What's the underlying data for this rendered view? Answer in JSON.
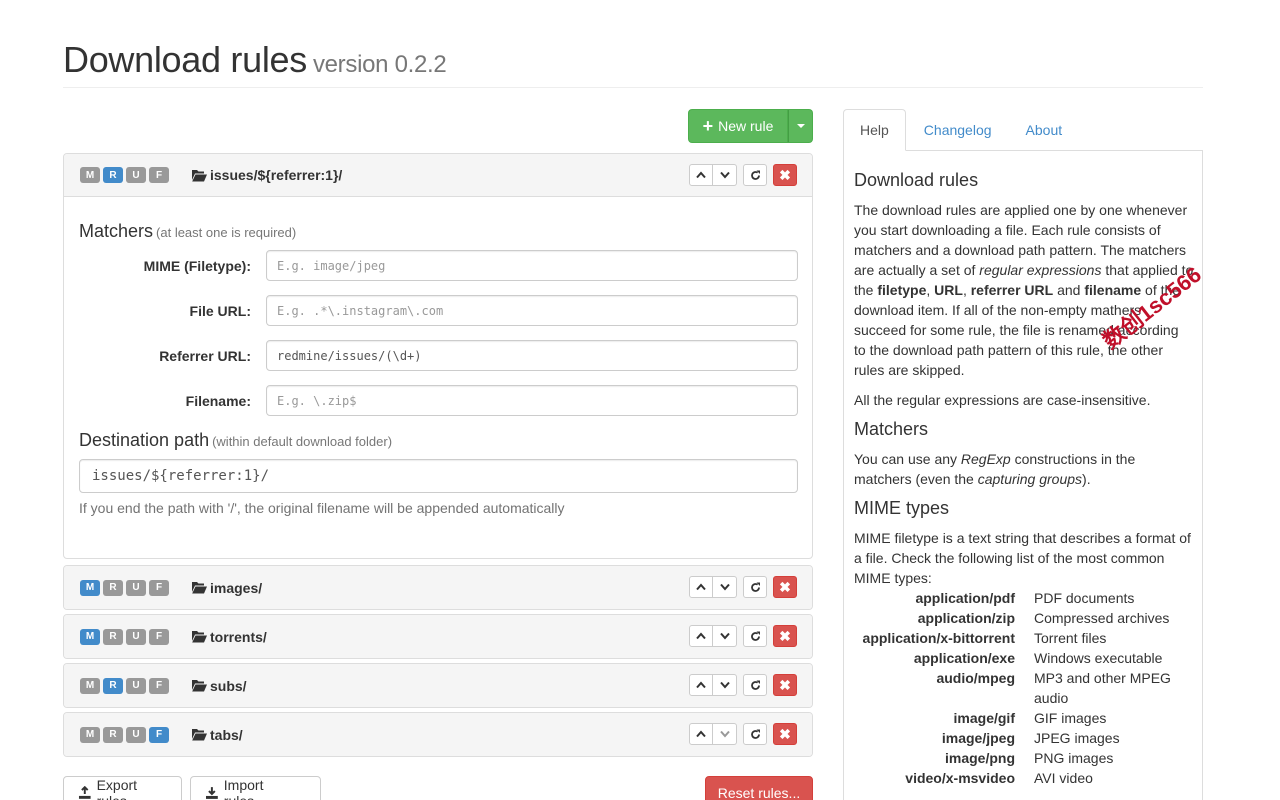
{
  "header": {
    "title": "Download rules",
    "version": "version 0.2.2"
  },
  "toolbar": {
    "new_rule_label": "New rule"
  },
  "badge_letters": [
    "M",
    "R",
    "U",
    "F"
  ],
  "rules": [
    {
      "title": "issues/${referrer:1}/",
      "active": [
        false,
        true,
        false,
        false
      ]
    },
    {
      "title": "images/",
      "active": [
        true,
        false,
        false,
        false
      ]
    },
    {
      "title": "torrents/",
      "active": [
        true,
        false,
        false,
        false
      ]
    },
    {
      "title": "subs/",
      "active": [
        false,
        true,
        false,
        false
      ]
    },
    {
      "title": "tabs/",
      "active": [
        false,
        false,
        false,
        true
      ]
    }
  ],
  "editor": {
    "matchers_title": "Matchers",
    "matchers_sub": "(at least one is required)",
    "fields": [
      {
        "label": "MIME (Filetype):",
        "value": "",
        "placeholder": "E.g. image/jpeg"
      },
      {
        "label": "File URL:",
        "value": "",
        "placeholder": "E.g. .*\\.instagram\\.com"
      },
      {
        "label": "Referrer URL:",
        "value": "redmine/issues/(\\d+)",
        "placeholder": ""
      },
      {
        "label": "Filename:",
        "value": "",
        "placeholder": "E.g. \\.zip$"
      }
    ],
    "dest_title": "Destination path",
    "dest_sub": "(within default download folder)",
    "dest_value": "issues/${referrer:1}/",
    "dest_help": "If you end the path with '/', the original filename will be appended automatically"
  },
  "bottom": {
    "export_label": "Export rules",
    "import_label": "Import rules...",
    "reset_label": "Reset rules..."
  },
  "tabs": [
    "Help",
    "Changelog",
    "About"
  ],
  "help": {
    "h1": "Download rules",
    "p1a": "The download rules are applied one by one whenever you start downloading a file. Each rule consists of matchers and a download path pattern. The matchers are actually a set of ",
    "p1_em": "regular expressions",
    "p1b": " that applied to the ",
    "p1_b1": "filetype",
    "p1_c1": ", ",
    "p1_b2": "URL",
    "p1_c2": ", ",
    "p1_b3": "referrer URL",
    "p1_c3": " and ",
    "p1_b4": "filename",
    "p1c": " of the download item. If all of the non-empty mathers succeed for some rule, the file is renamed according to the download path pattern of this rule, the other rules are skipped.",
    "p2": "All the regular expressions are case-insensitive.",
    "h2": "Matchers",
    "p3a": "You can use any ",
    "p3_em1": "RegExp",
    "p3b": " constructions in the matchers (even the ",
    "p3_em2": "capturing groups",
    "p3c": ").",
    "h3": "MIME types",
    "p4": "MIME filetype is a text string that describes a format of a file. Check the following list of the most common MIME types:",
    "mime": [
      {
        "type": "application/pdf",
        "desc": "PDF documents"
      },
      {
        "type": "application/zip",
        "desc": "Compressed archives"
      },
      {
        "type": "application/x-bittorrent",
        "desc": "Torrent files"
      },
      {
        "type": "application/exe",
        "desc": "Windows executable"
      },
      {
        "type": "audio/mpeg",
        "desc": "MP3 and other MPEG audio"
      },
      {
        "type": "image/gif",
        "desc": "GIF images"
      },
      {
        "type": "image/jpeg",
        "desc": "JPEG images"
      },
      {
        "type": "image/png",
        "desc": "PNG images"
      },
      {
        "type": "video/x-msvideo",
        "desc": "AVI video"
      }
    ]
  },
  "watermark": "数创1sc566",
  "colors": {
    "success": "#5cb85c",
    "primary": "#428bca",
    "danger": "#d9534f",
    "badge_off": "#999999"
  }
}
